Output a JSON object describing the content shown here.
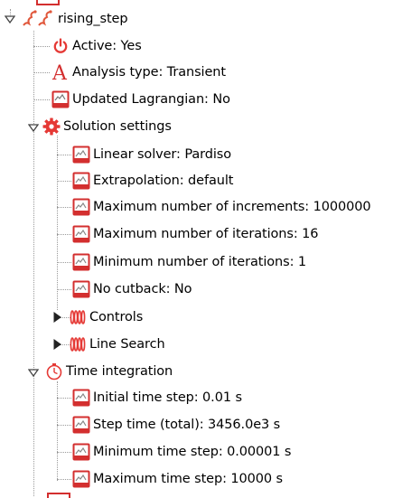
{
  "tree": {
    "root": {
      "label": "rising_step",
      "icon": "springs-icon",
      "children": {
        "active": {
          "label": "Active: Yes",
          "icon": "power-icon"
        },
        "analysis_type": {
          "label": "Analysis type: Transient",
          "icon": "letter-a-icon"
        },
        "updated_lagrangian": {
          "label": "Updated Lagrangian: No",
          "icon": "setting-icon"
        },
        "solution_settings": {
          "label": "Solution settings",
          "icon": "gear-icon",
          "children": {
            "linear_solver": {
              "label": "Linear solver: Pardiso"
            },
            "extrapolation": {
              "label": "Extrapolation: default"
            },
            "max_increments": {
              "label": "Maximum number of increments: 1000000"
            },
            "max_iterations": {
              "label": "Maximum number of iterations: 16"
            },
            "min_iterations": {
              "label": "Minimum number of iterations: 1"
            },
            "no_cutback": {
              "label": "No cutback: No"
            },
            "controls": {
              "label": "Controls",
              "icon": "coil-icon"
            },
            "line_search": {
              "label": "Line Search",
              "icon": "coil-icon"
            }
          }
        },
        "time_integration": {
          "label": "Time integration",
          "icon": "stopwatch-icon",
          "children": {
            "initial_step": {
              "label": "Initial time step: 0.01 s"
            },
            "step_time": {
              "label": "Step time (total): 3456.0e3 s"
            },
            "min_step": {
              "label": "Minimum time step: 0.00001 s"
            },
            "max_step": {
              "label": "Maximum time step: 10000 s"
            }
          }
        }
      }
    }
  }
}
